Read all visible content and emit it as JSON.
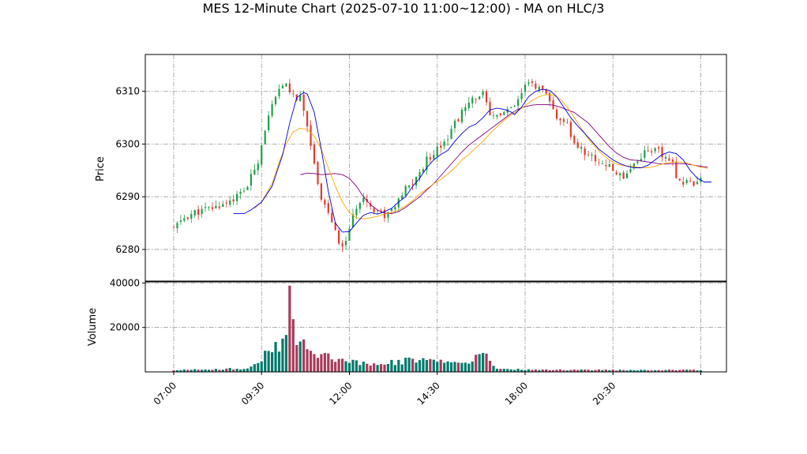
{
  "chart_data": {
    "type": "candlestick",
    "title": "MES 12-Minute Chart (2025-07-10 11:00~12:00) - MA on HLC/3",
    "price_panel": {
      "ylabel": "Price",
      "ylim": [
        6274,
        6317
      ],
      "yticks": [
        6280,
        6290,
        6300,
        6310
      ],
      "grid": true
    },
    "volume_panel": {
      "ylabel": "Volume",
      "ylim": [
        0,
        40500
      ],
      "yticks": [
        20000,
        40000
      ],
      "grid": true
    },
    "x_ticks": [
      "07:00",
      "09:30",
      "12:00",
      "14:30",
      "18:00",
      "20:30"
    ],
    "up_color": "#1f9e4a",
    "down_color": "#e23b2e",
    "volume_up_color": "#007a6c",
    "volume_down_color": "#a83a5a",
    "ma_series": [
      {
        "color": "#0000dd"
      },
      {
        "color": "#ffa500"
      },
      {
        "color": "#800080"
      }
    ],
    "ma_blue": [
      [
        17,
        6286.8
      ],
      [
        20,
        6286.8
      ],
      [
        22,
        6287.5
      ],
      [
        25,
        6289
      ],
      [
        28,
        6292
      ],
      [
        31,
        6298
      ],
      [
        33,
        6304
      ],
      [
        35,
        6308.8
      ],
      [
        37,
        6309.8
      ],
      [
        38,
        6309.5
      ],
      [
        40,
        6306
      ],
      [
        42,
        6299
      ],
      [
        44,
        6291
      ],
      [
        46,
        6285
      ],
      [
        48,
        6283.3
      ],
      [
        50,
        6283.4
      ],
      [
        52,
        6285
      ],
      [
        54,
        6286.5
      ],
      [
        56,
        6287
      ],
      [
        58,
        6286.7
      ],
      [
        60,
        6287.2
      ],
      [
        62,
        6287.8
      ],
      [
        64,
        6289
      ],
      [
        66,
        6290
      ],
      [
        68,
        6292
      ],
      [
        70,
        6293.5
      ],
      [
        72,
        6295.5
      ],
      [
        74,
        6297
      ],
      [
        76,
        6298
      ],
      [
        78,
        6298.8
      ],
      [
        80,
        6300.5
      ],
      [
        82,
        6302
      ],
      [
        84,
        6303.2
      ],
      [
        86,
        6303.8
      ],
      [
        88,
        6305
      ],
      [
        90,
        6306.5
      ],
      [
        92,
        6306.8
      ],
      [
        94,
        6306.6
      ],
      [
        96,
        6306.1
      ],
      [
        97,
        6305.6
      ],
      [
        99,
        6307
      ],
      [
        101,
        6309
      ],
      [
        103,
        6310
      ],
      [
        105,
        6310.4
      ],
      [
        107,
        6310.2
      ],
      [
        109,
        6309
      ],
      [
        111,
        6307
      ],
      [
        113,
        6305
      ],
      [
        115,
        6303.4
      ],
      [
        117,
        6302
      ],
      [
        119,
        6300.5
      ],
      [
        121,
        6299
      ],
      [
        123,
        6298
      ],
      [
        125,
        6297
      ],
      [
        127,
        6296.3
      ],
      [
        129,
        6295.8
      ],
      [
        131,
        6295.5
      ],
      [
        133,
        6295.5
      ],
      [
        135,
        6296
      ],
      [
        137,
        6297
      ],
      [
        139,
        6298
      ],
      [
        141,
        6298.5
      ],
      [
        143,
        6298.2
      ],
      [
        145,
        6297
      ],
      [
        147,
        6295
      ],
      [
        149,
        6293.5
      ],
      [
        151,
        6292.8
      ],
      [
        153,
        6292.8
      ]
    ],
    "ma_orange": [
      [
        23,
        6287.8
      ],
      [
        25,
        6289
      ],
      [
        28,
        6292.5
      ],
      [
        30,
        6296.5
      ],
      [
        32,
        6300
      ],
      [
        34,
        6302.3
      ],
      [
        36,
        6303
      ],
      [
        38,
        6302.8
      ],
      [
        40,
        6301.5
      ],
      [
        42,
        6299
      ],
      [
        44,
        6295.5
      ],
      [
        46,
        6292
      ],
      [
        48,
        6289
      ],
      [
        50,
        6287
      ],
      [
        52,
        6286
      ],
      [
        54,
        6285.8
      ],
      [
        56,
        6286
      ],
      [
        58,
        6286.3
      ],
      [
        60,
        6286.7
      ],
      [
        62,
        6287
      ],
      [
        64,
        6287.5
      ],
      [
        66,
        6288.3
      ],
      [
        68,
        6289.3
      ],
      [
        70,
        6290.5
      ],
      [
        72,
        6291.5
      ],
      [
        74,
        6292.5
      ],
      [
        76,
        6293.3
      ],
      [
        78,
        6294.3
      ],
      [
        80,
        6295.5
      ],
      [
        82,
        6297
      ],
      [
        84,
        6298
      ],
      [
        86,
        6299.3
      ],
      [
        88,
        6300.5
      ],
      [
        90,
        6302
      ],
      [
        92,
        6303.3
      ],
      [
        94,
        6304.5
      ],
      [
        96,
        6305.5
      ],
      [
        98,
        6306.3
      ],
      [
        100,
        6307.3
      ],
      [
        102,
        6308.3
      ],
      [
        104,
        6309
      ],
      [
        106,
        6309.4
      ],
      [
        108,
        6309.3
      ],
      [
        110,
        6308.5
      ],
      [
        112,
        6307
      ],
      [
        114,
        6305
      ],
      [
        116,
        6303
      ],
      [
        118,
        6301
      ],
      [
        120,
        6299.5
      ],
      [
        122,
        6298
      ],
      [
        124,
        6297
      ],
      [
        126,
        6296.2
      ],
      [
        128,
        6295.9
      ],
      [
        130,
        6295.8
      ],
      [
        132,
        6295.6
      ],
      [
        134,
        6295.5
      ],
      [
        136,
        6295.6
      ],
      [
        138,
        6296
      ],
      [
        140,
        6296.4
      ],
      [
        142,
        6296.6
      ],
      [
        144,
        6296.6
      ],
      [
        146,
        6296.4
      ],
      [
        148,
        6296
      ],
      [
        150,
        6295.6
      ],
      [
        152,
        6295.4
      ]
    ],
    "ma_purple": [
      [
        36,
        6294.2
      ],
      [
        38,
        6294.5
      ],
      [
        40,
        6294.4
      ],
      [
        42,
        6294.2
      ],
      [
        44,
        6294.3
      ],
      [
        46,
        6294.4
      ],
      [
        48,
        6294.2
      ],
      [
        50,
        6293.5
      ],
      [
        52,
        6292
      ],
      [
        54,
        6290
      ],
      [
        56,
        6288.5
      ],
      [
        58,
        6287.5
      ],
      [
        60,
        6286.9
      ],
      [
        62,
        6286.8
      ],
      [
        64,
        6287.2
      ],
      [
        66,
        6288
      ],
      [
        68,
        6289
      ],
      [
        70,
        6290
      ],
      [
        72,
        6291.3
      ],
      [
        74,
        6292.5
      ],
      [
        76,
        6294
      ],
      [
        78,
        6295.5
      ],
      [
        80,
        6297
      ],
      [
        82,
        6298.5
      ],
      [
        84,
        6299.8
      ],
      [
        86,
        6300.8
      ],
      [
        88,
        6301.8
      ],
      [
        90,
        6302.8
      ],
      [
        92,
        6303.8
      ],
      [
        94,
        6304.8
      ],
      [
        96,
        6305.8
      ],
      [
        98,
        6306.6
      ],
      [
        100,
        6307.1
      ],
      [
        102,
        6307.4
      ],
      [
        104,
        6307.5
      ],
      [
        106,
        6307.5
      ],
      [
        108,
        6307.4
      ],
      [
        110,
        6307
      ],
      [
        112,
        6306.5
      ],
      [
        114,
        6306
      ],
      [
        116,
        6305
      ],
      [
        118,
        6304
      ],
      [
        120,
        6302.5
      ],
      [
        122,
        6301
      ],
      [
        124,
        6299.5
      ],
      [
        126,
        6298.3
      ],
      [
        128,
        6297.5
      ],
      [
        130,
        6297
      ],
      [
        132,
        6296.9
      ],
      [
        134,
        6296.7
      ],
      [
        136,
        6296.5
      ],
      [
        138,
        6296.3
      ],
      [
        140,
        6296.2
      ],
      [
        142,
        6296.3
      ],
      [
        144,
        6296.3
      ],
      [
        146,
        6296.2
      ],
      [
        148,
        6296
      ],
      [
        150,
        6295.8
      ],
      [
        152,
        6295.6
      ]
    ]
  }
}
